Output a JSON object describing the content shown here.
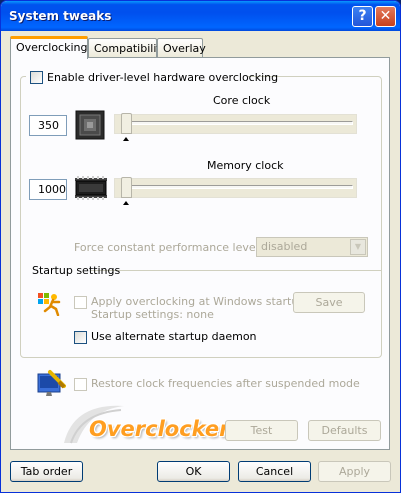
{
  "window": {
    "title": "System tweaks",
    "help_glyph": "?",
    "close_glyph": "✕"
  },
  "tabs": [
    {
      "label": "Overclocking",
      "active": true
    },
    {
      "label": "Compatibility",
      "active": false
    },
    {
      "label": "Overlay",
      "active": false
    }
  ],
  "overclocking": {
    "enable_label": "Enable driver-level hardware overclocking",
    "enable_checked": false,
    "core": {
      "title": "Core clock",
      "value": "350",
      "slider_position": 0.0
    },
    "memory": {
      "title": "Memory clock",
      "value": "1000",
      "slider_position": 0.0
    },
    "perf_label": "Force constant performance level",
    "perf_value": "disabled"
  },
  "startup": {
    "title": "Startup settings",
    "apply_label": "Apply overclocking at Windows startup",
    "settings_line": "Startup settings: none",
    "save_label": "Save",
    "alt_daemon_label": "Use alternate startup daemon",
    "alt_daemon_checked": false
  },
  "restore_label": "Restore clock frequencies after suspended mode",
  "logo_text": "Overclockers.ru",
  "panel_buttons": {
    "test": "Test",
    "defaults": "Defaults"
  },
  "footer": {
    "tab_order": "Tab order",
    "ok": "OK",
    "cancel": "Cancel",
    "apply": "Apply"
  },
  "colors": {
    "title_bar": "#0054e3",
    "active_tab_accent": "#ff9e00",
    "logo": "#ff9e21"
  }
}
